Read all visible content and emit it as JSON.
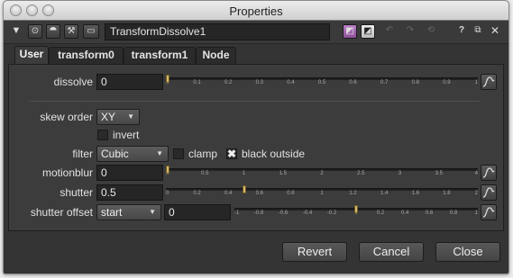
{
  "window": {
    "title": "Properties"
  },
  "toolbar": {
    "node_name": "TransformDissolve1",
    "help_label": "?"
  },
  "tabs": [
    {
      "label": "User"
    },
    {
      "label": "transform0"
    },
    {
      "label": "transform1"
    },
    {
      "label": "Node"
    }
  ],
  "knobs": {
    "dissolve": {
      "label": "dissolve",
      "value": "0",
      "ticks": [
        "0",
        "0.1",
        "0.2",
        "0.3",
        "0.4",
        "0.5",
        "0.6",
        "0.7",
        "0.8",
        "0.9",
        "1"
      ],
      "handle": 0.0
    },
    "skew_order": {
      "label": "skew order",
      "value": "XY"
    },
    "invert": {
      "label": "invert",
      "checked": false
    },
    "filter": {
      "label": "filter",
      "value": "Cubic"
    },
    "clamp": {
      "label": "clamp",
      "checked": false
    },
    "black_outside": {
      "label": "black outside",
      "checked": true
    },
    "motionblur": {
      "label": "motionblur",
      "value": "0",
      "ticks": [
        "0",
        "0.5",
        "1",
        "1.5",
        "2",
        "2.5",
        "3",
        "3.5",
        "4"
      ],
      "handle": 0.0
    },
    "shutter": {
      "label": "shutter",
      "value": "0.5",
      "ticks": [
        "0",
        "0.2",
        "0.4",
        "0.6",
        "0.8",
        "1",
        "1.2",
        "1.4",
        "1.6",
        "1.8",
        "2"
      ],
      "handle": 0.25
    },
    "shutter_offset": {
      "label": "shutter offset",
      "mode": "start",
      "value": "0",
      "ticks": [
        "-1",
        "-0.8",
        "-0.6",
        "-0.4",
        "-0.2",
        "0",
        "0.2",
        "0.4",
        "0.6",
        "0.8",
        "1"
      ],
      "handle": 0.5
    }
  },
  "footer": {
    "revert_label": "Revert",
    "cancel_label": "Cancel",
    "close_label": "Close"
  },
  "colors": {
    "panel_bg": "#3c3c3c",
    "slider_handle": "#d6b86a"
  }
}
